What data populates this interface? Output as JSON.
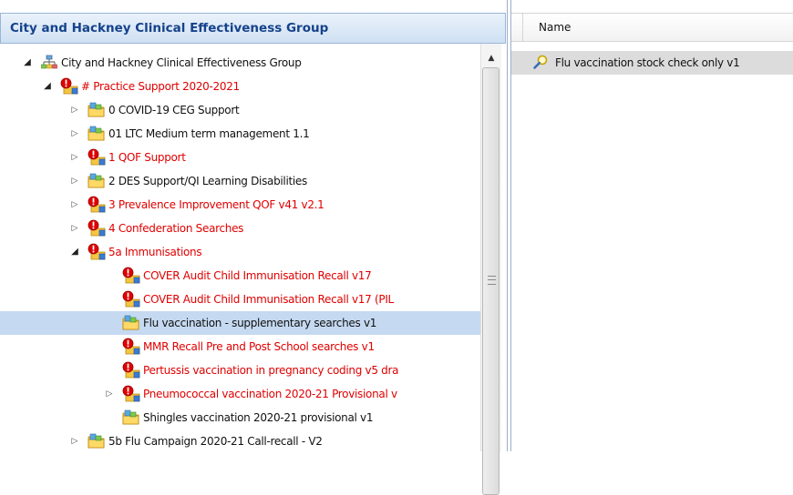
{
  "left_panel": {
    "title": "City and Hackney Clinical Effectiveness Group"
  },
  "tree": [
    {
      "label": "City and Hackney Clinical Effectiveness Group",
      "icon": "network-icon",
      "expander": "open",
      "color": "black",
      "level": 0
    },
    {
      "label": "# Practice Support 2020-2021",
      "icon": "restricted-folder-icon",
      "expander": "open",
      "color": "red",
      "level": 1
    },
    {
      "label": "0 COVID-19 CEG Support",
      "icon": "shared-folder-icon",
      "expander": "closed",
      "color": "black",
      "level": 2
    },
    {
      "label": "01 LTC Medium term management 1.1",
      "icon": "shared-folder-icon",
      "expander": "closed",
      "color": "black",
      "level": 2
    },
    {
      "label": "1 QOF Support",
      "icon": "restricted-folder-icon",
      "expander": "closed",
      "color": "red",
      "level": 2
    },
    {
      "label": "2 DES Support/QI Learning Disabilities",
      "icon": "shared-folder-icon",
      "expander": "closed",
      "color": "black",
      "level": 2
    },
    {
      "label": "3 Prevalence Improvement QOF v41 v2.1",
      "icon": "restricted-folder-icon",
      "expander": "closed",
      "color": "red",
      "level": 2
    },
    {
      "label": "4 Confederation Searches",
      "icon": "restricted-folder-icon",
      "expander": "closed",
      "color": "red",
      "level": 2
    },
    {
      "label": "5a Immunisations",
      "icon": "restricted-folder-icon",
      "expander": "open",
      "color": "red",
      "level": 2
    },
    {
      "label": "COVER Audit Child Immunisation Recall v17",
      "icon": "restricted-folder-icon",
      "expander": "none",
      "color": "red",
      "level": 3
    },
    {
      "label": "COVER Audit Child Immunisation Recall v17 (PIL",
      "icon": "restricted-folder-icon",
      "expander": "none",
      "color": "red",
      "level": 3
    },
    {
      "label": "Flu vaccination - supplementary searches v1",
      "icon": "shared-folder-icon",
      "expander": "none",
      "color": "black",
      "level": 3,
      "selected": true
    },
    {
      "label": "MMR Recall Pre and Post School searches v1",
      "icon": "restricted-folder-icon",
      "expander": "none",
      "color": "red",
      "level": 3
    },
    {
      "label": "Pertussis vaccination in pregnancy coding v5 dra",
      "icon": "restricted-folder-icon",
      "expander": "none",
      "color": "red",
      "level": 3
    },
    {
      "label": "Pneumococcal vaccination 2020-21 Provisional v",
      "icon": "restricted-folder-icon",
      "expander": "closed",
      "color": "red",
      "level": 3
    },
    {
      "label": "Shingles vaccination 2020-21 provisional v1",
      "icon": "shared-folder-icon",
      "expander": "none",
      "color": "black",
      "level": 3
    },
    {
      "label": "5b Flu Campaign 2020-21 Call-recall - V2",
      "icon": "shared-folder-icon",
      "expander": "closed",
      "color": "black",
      "level": 2
    }
  ],
  "right_panel": {
    "column_header": "Name",
    "results": [
      {
        "label": "Flu vaccination stock check only v1",
        "icon": "search-magnifier-icon"
      }
    ]
  },
  "colors": {
    "header_text": "#15428b",
    "restricted_text": "#e00000",
    "selection": "#c5d9f1"
  }
}
